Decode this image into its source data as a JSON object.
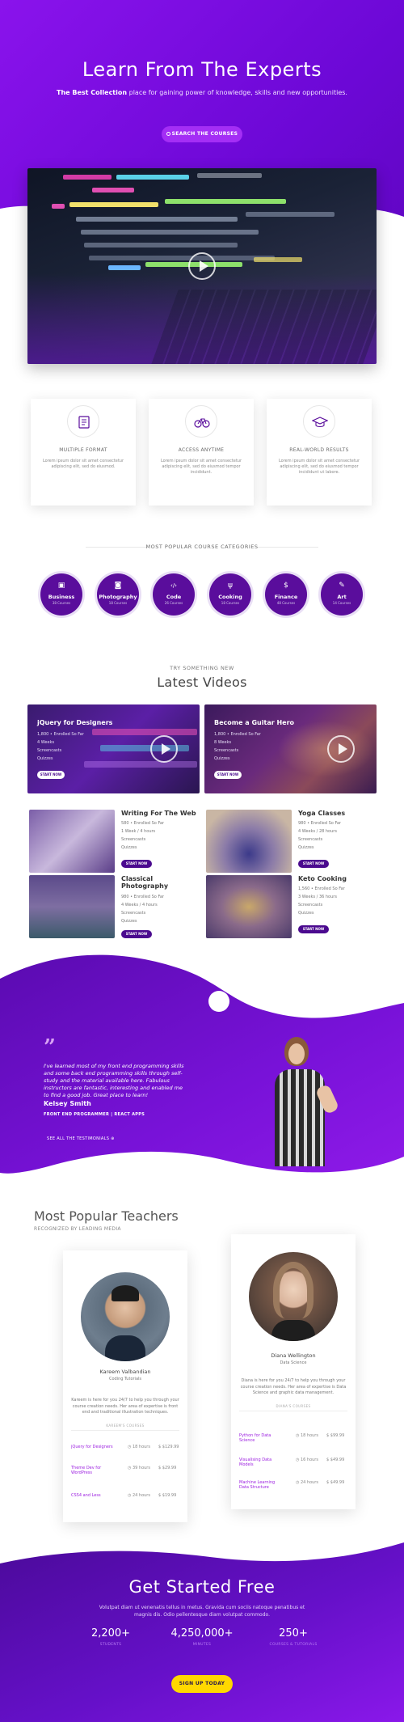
{
  "hero": {
    "title": "Learn From The Experts",
    "subtitle_bold": "The Best Collection",
    "subtitle_rest": " place for gaining power of knowledge, skills and new opportunities.",
    "search_button": "SEARCH THE COURSES",
    "video_code_lines": [
      "@package _s",
      "if ( ! function_exists( 'incode_starter_setup' ) ) :",
      "* Sets up theme defaults and registers support for various",
      "* Note that this function is hooked into the after_setup_theme",
      "* runs before the init hook. The init hook is too late",
      "* as indicating support for post thumbnails.",
      "function incode_starter_setup() {"
    ]
  },
  "features": [
    {
      "title": "MULTIPLE FORMAT",
      "desc": "Lorem ipsum dolor sit amet consectetur adipiscing elit, sed do eiusmod.",
      "icon": "stack-icon"
    },
    {
      "title": "ACCESS ANYTIME",
      "desc": "Lorem ipsum dolor sit amet consectetur adipiscing elit, sed do eiusmod tempor incididunt.",
      "icon": "bicycle-icon"
    },
    {
      "title": "REAL-WORLD RESULTS",
      "desc": "Lorem ipsum dolor sit amet consectetur adipiscing elit, sed do eiusmod tempor incididunt ut labore.",
      "icon": "graduation-cap-icon"
    }
  ],
  "categories": {
    "heading": "MOST POPULAR COURSE CATEGORIES",
    "items": [
      {
        "name": "Business",
        "count": "38 Courses",
        "icon": "briefcase-icon",
        "glyph": "▣"
      },
      {
        "name": "Photography",
        "count": "18 Courses",
        "icon": "camera-icon",
        "glyph": "◙"
      },
      {
        "name": "Code",
        "count": "26 Courses",
        "icon": "code-icon",
        "glyph": "‹/›"
      },
      {
        "name": "Cooking",
        "count": "18 Courses",
        "icon": "utensils-icon",
        "glyph": "ψ"
      },
      {
        "name": "Finance",
        "count": "48 Courses",
        "icon": "dollar-icon",
        "glyph": "$"
      },
      {
        "name": "Art",
        "count": "14 Courses",
        "icon": "brush-icon",
        "glyph": "✎"
      }
    ]
  },
  "latest": {
    "eyebrow": "TRY SOMETHING NEW",
    "title": "Latest Videos",
    "featured": [
      {
        "title": "jQuery for Designers",
        "meta": [
          "1,800 • Enrolled So Far",
          "4 Weeks",
          "Screencasts",
          "Quizzes"
        ],
        "button": "START NOW"
      },
      {
        "title": "Become a Guitar Hero",
        "meta": [
          "1,800 • Enrolled So Far",
          "8 Weeks",
          "Screencasts",
          "Quizzes"
        ],
        "button": "START NOW"
      }
    ],
    "courses": [
      {
        "title": "Writing For The Web",
        "meta": [
          "580 • Enrolled So Far",
          "1 Week / 4 hours",
          "Screencasts",
          "Quizzes"
        ],
        "button": "START NOW"
      },
      {
        "title": "Yoga Classes",
        "meta": [
          "980 • Enrolled So Far",
          "4 Weeks / 28 hours",
          "Screencasts",
          "Quizzes"
        ],
        "button": "START NOW"
      },
      {
        "title": "Classical Photography",
        "meta": [
          "980 • Enrolled So Far",
          "4 Weeks / 4 hours",
          "Screencasts",
          "Quizzes"
        ],
        "button": "START NOW"
      },
      {
        "title": "Keto Cooking",
        "meta": [
          "1,560 • Enrolled So Far",
          "3 Weeks / 36 hours",
          "Screencasts",
          "Quizzes"
        ],
        "button": "START NOW"
      }
    ]
  },
  "testimonial": {
    "quote": "I've learned most of my front end programming skills and some back end programming skills through self-study and the material available here. Fabulous instructors are fantastic, interesting and enabled me to find a good job. Great place to learn!",
    "name": "Kelsey Smith",
    "role": "FRONT END PROGRAMMER | REACT APPS",
    "link": "SEE ALL THE TESTIMONIALS ⊕"
  },
  "teachers": {
    "title": "Most Popular Teachers",
    "subtitle": "RECOGNIZED BY LEADING MEDIA",
    "cards": [
      {
        "name": "Kareem Valbandian",
        "role": "Coding Tutorials",
        "bio": "Kareem is here for you 24/7 to help you through your course creation needs. Her area of expertise is front end and traditional illustration techniques.",
        "courses_label": "KAREEM'S COURSES",
        "courses": [
          {
            "name": "jQuery for Designers",
            "hours": "18 hours",
            "price": "$129.99"
          },
          {
            "name": "Theme Dev for WordPress",
            "hours": "39 hours",
            "price": "$29.99"
          },
          {
            "name": "CSS4 and Less",
            "hours": "24 hours",
            "price": "$19.99"
          }
        ]
      },
      {
        "name": "Diana Wellington",
        "role": "Data Science",
        "bio": "Diana is here for you 24/7 to help you through your course creation needs. Her area of expertise is Data Science and graphic data management.",
        "courses_label": "DIANA'S COURSES",
        "courses": [
          {
            "name": "Python for Data Science",
            "hours": "18 hours",
            "price": "$99.99"
          },
          {
            "name": "Visualising Data Models",
            "hours": "16 hours",
            "price": "$49.99"
          },
          {
            "name": "Machine Learning Data Structure",
            "hours": "24 hours",
            "price": "$49.99"
          }
        ]
      }
    ]
  },
  "cta": {
    "title": "Get Started Free",
    "text": "Volutpat diam ut venenatis tellus in metus. Gravida cum sociis natoque penatibus et magnis dis. Odio pellentesque diam volutpat commodo.",
    "stats": [
      {
        "value": "2,200+",
        "label": "STUDENTS"
      },
      {
        "value": "4,250,000+",
        "label": "MINUTES"
      },
      {
        "value": "250+",
        "label": "COURSES & TUTORIALS"
      }
    ],
    "button": "SIGN UP TODAY"
  },
  "colors": {
    "brand_purple": "#7a0fe0",
    "deep_purple": "#4b0a8f",
    "accent_yellow": "#ffd800"
  }
}
